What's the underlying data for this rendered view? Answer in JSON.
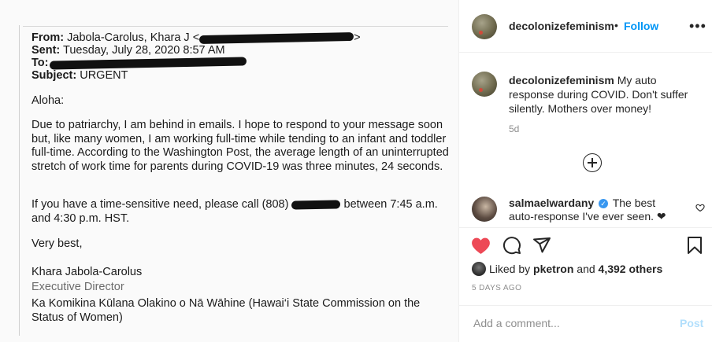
{
  "email": {
    "from_label": "From:",
    "from_value": "Jabola-Carolus, Khara J <",
    "from_tail": ">",
    "sent_label": "Sent:",
    "sent_value": "Tuesday, July 28, 2020 8:57 AM",
    "to_label": "To:",
    "subject_label": "Subject:",
    "subject_value": "URGENT",
    "greeting": "Aloha:",
    "para1": "Due to patriarchy, I am behind in emails. I hope to respond to your message soon but, like many women, I am working full-time while tending to an infant and toddler full-time. According to the Washington Post, the average length of an uninterrupted stretch of work time for parents during COVID-19 was three minutes, 24 seconds.",
    "para2_a": "If you have a time-sensitive need, please call (808)",
    "para2_b": "between 7:45 a.m. and 4:30 p.m. HST.",
    "signoff": "Very best,",
    "sig_name": "Khara Jabola-Carolus",
    "sig_title": "Executive Director",
    "sig_org": "Ka Komikina Kūlana Olakino o Nā Wāhine (Hawai‘i State Commission on the Status of Women)"
  },
  "post": {
    "username": "decolonizefeminism",
    "separator": "•",
    "follow_label": "Follow",
    "more_icon": "more-horizontal-icon",
    "caption_user": "decolonizefeminism",
    "caption_text": "My auto response during COVID. Don't suffer silently. Mothers over money!",
    "caption_age": "5d",
    "comment_user": "salmaelwardany",
    "comment_verified_glyph": "✓",
    "comment_text": "The best auto-response I've ever seen. ❤",
    "liked_prefix": "Liked by",
    "liked_user": "pketron",
    "liked_and": "and",
    "liked_others": "4,392 others",
    "date": "5 DAYS AGO",
    "add_comment_placeholder": "Add a comment...",
    "post_label": "Post",
    "like_color": "#ed4956",
    "link_color": "#0095f6"
  }
}
